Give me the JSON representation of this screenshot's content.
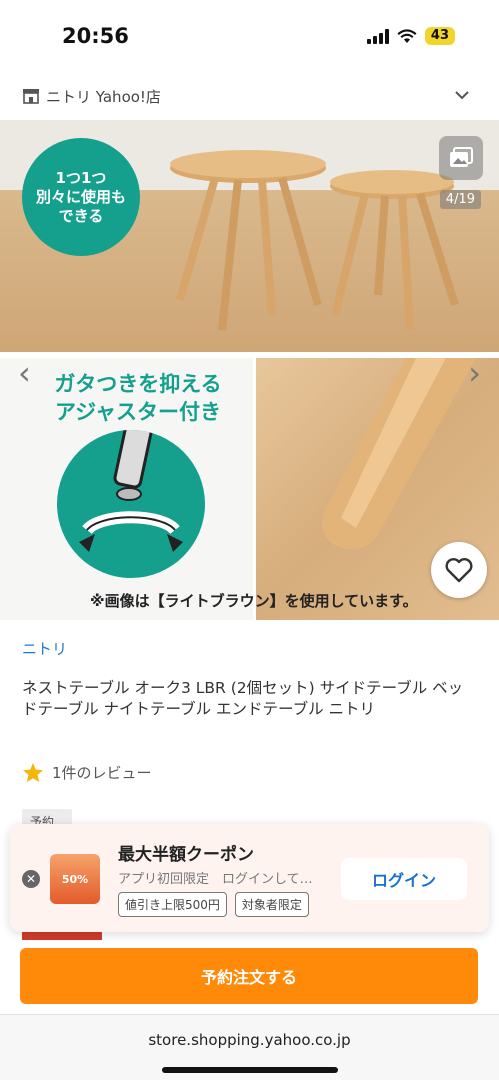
{
  "status_bar": {
    "time": "20:56",
    "battery": "43"
  },
  "header": {
    "store_name": "ニトリ Yahoo!店"
  },
  "gallery": {
    "counter": "4/19",
    "badge_text": "1つ1つ\n別々に使用も\nできる",
    "feature_text": "ガタつきを抑える\nアジャスター付き",
    "caption": "※画像は【ライトブラウン】を使用しています。"
  },
  "product": {
    "brand": "ニトリ",
    "title": "ネストテーブル オーク3 LBR (2個セット) サイドテーブル ベッドテーブル ナイトテーブル エンドテーブル ニトリ",
    "review_count": "1件のレビュー",
    "reserve_tag": "予約"
  },
  "coupon": {
    "thumb_text": "50%",
    "title": "最大半額クーポン",
    "subtitle": "アプリ初回限定　ログインして…",
    "tags": [
      "値引き上限500円",
      "対象者限定"
    ],
    "login_label": "ログイン"
  },
  "order_button": "予約注文する",
  "url": "store.shopping.yahoo.co.jp",
  "colors": {
    "accent_green": "#15a08e",
    "order_orange": "#ff8a0a",
    "link_blue": "#2577c9"
  }
}
